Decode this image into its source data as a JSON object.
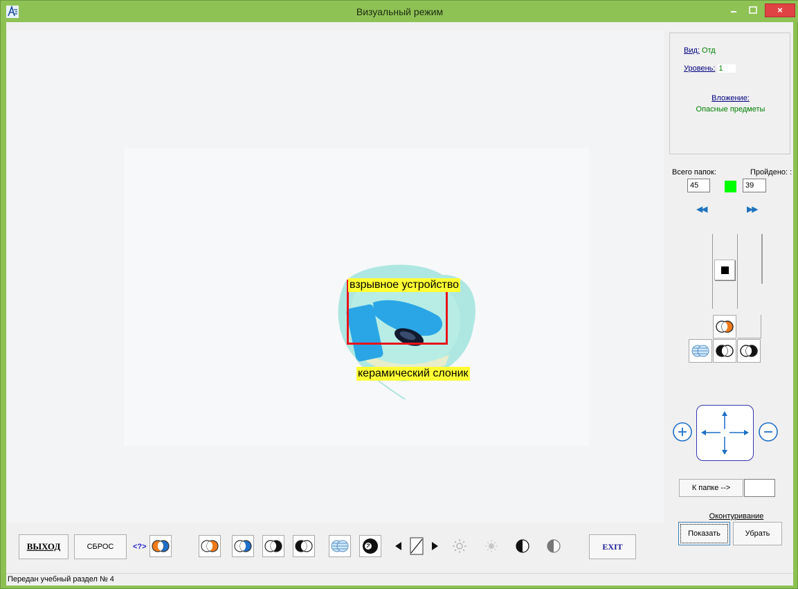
{
  "window": {
    "title": "Визуальный режим",
    "close_glyph": "×",
    "accent_color": "#8fc255"
  },
  "viewport": {
    "labels": {
      "detected_object": "взрывное устройство",
      "other_object": "керамический слоник"
    },
    "highlight_color": "#e8141a",
    "label_bg_color": "#ffff33"
  },
  "info": {
    "view_label": "Вид:",
    "view_value": "Отд",
    "level_label": "Уровень:",
    "level_value": "1",
    "attachment_label": "Вложение:",
    "attachment_value": "Опасные предметы"
  },
  "progress": {
    "total_label": "Всего папок:",
    "passed_label": "Пройдено: :",
    "total_value": "45",
    "passed_value": "39",
    "prev_glyph": "◀◀",
    "next_glyph": "▶▶"
  },
  "pan_controls": {
    "zoom_in_icon": "zoom-in-icon",
    "zoom_out_icon": "zoom-out-icon"
  },
  "folder": {
    "goto_label": "К папке -->",
    "goto_value": ""
  },
  "contour": {
    "title": "Оконтуривание",
    "show_label": "Показать",
    "remove_label": "Убрать"
  },
  "toolbar": {
    "exit_ru_label": "ВЫХОД",
    "reset_label": "СБРОС",
    "help_label": "<?>",
    "exit_label": "EXIT"
  },
  "status": {
    "text": "Передан учебный раздел № 4"
  }
}
